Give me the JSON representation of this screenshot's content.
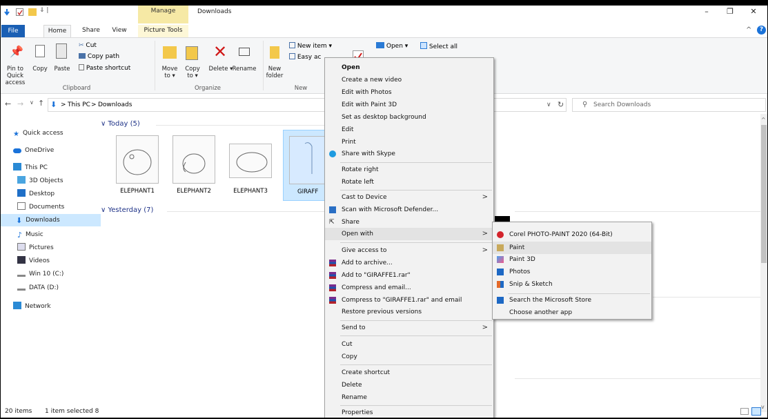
{
  "titlebar": {
    "manage_label": "Manage",
    "window_title": "Downloads",
    "minimize": "–",
    "maximize": "❐",
    "close": "✕"
  },
  "tabs": {
    "file": "File",
    "home": "Home",
    "share": "Share",
    "view": "View",
    "picture_tools": "Picture Tools"
  },
  "ribbon": {
    "pin_label": "Pin to Quick access",
    "copy_label": "Copy",
    "paste_label": "Paste",
    "cut": "Cut",
    "copy_path": "Copy path",
    "paste_shortcut": "Paste shortcut",
    "clipboard_group": "Clipboard",
    "move_to": "Move to ▾",
    "copy_to": "Copy to ▾",
    "delete": "Delete ▾",
    "rename": "Rename",
    "organize_group": "Organize",
    "new_folder": "New folder",
    "new_item": "New item ▾",
    "easy_access": "Easy ac",
    "new_group": "New",
    "open": "Open ▾",
    "select_all": "Select all"
  },
  "address": {
    "path_root": "This PC",
    "path_sep": ">",
    "path_current": "Downloads",
    "search_placeholder": "Search Downloads"
  },
  "nav": {
    "items": [
      {
        "label": "Quick access",
        "icon": "star-icon"
      },
      {
        "label": "OneDrive",
        "icon": "cloud-icon"
      },
      {
        "label": "This PC",
        "icon": "pc-icon"
      },
      {
        "label": "3D Objects",
        "icon": "cube-icon"
      },
      {
        "label": "Desktop",
        "icon": "desktop-icon"
      },
      {
        "label": "Documents",
        "icon": "document-icon"
      },
      {
        "label": "Downloads",
        "icon": "download-icon"
      },
      {
        "label": "Music",
        "icon": "music-icon"
      },
      {
        "label": "Pictures",
        "icon": "pictures-icon"
      },
      {
        "label": "Videos",
        "icon": "video-icon"
      },
      {
        "label": "Win 10  (C:)",
        "icon": "drive-icon"
      },
      {
        "label": "DATA (D:)",
        "icon": "drive-icon"
      },
      {
        "label": "Network",
        "icon": "network-icon"
      }
    ]
  },
  "content": {
    "group_today": "Today (5)",
    "group_yesterday": "Yesterday (7)",
    "files": [
      "ELEPHANT1",
      "ELEPHANT2",
      "ELEPHANT3",
      "GIRAFF"
    ]
  },
  "status": {
    "items_count": "20 items",
    "selected": "1 item selected  8"
  },
  "context_menu": {
    "items": [
      "Open",
      "Create a new video",
      "Edit with Photos",
      "Edit with Paint 3D",
      "Set as desktop background",
      "Edit",
      "Print",
      "Share with Skype",
      "Rotate right",
      "Rotate left",
      "Cast to Device",
      "Scan with Microsoft Defender...",
      "Share",
      "Open with",
      "Give access to",
      "Add to archive...",
      "Add to \"GIRAFFE1.rar\"",
      "Compress and email...",
      "Compress to \"GIRAFFE1.rar\" and email",
      "Restore previous versions",
      "Send to",
      "Cut",
      "Copy",
      "Create shortcut",
      "Delete",
      "Rename",
      "Properties"
    ]
  },
  "open_with_menu": {
    "items": [
      "Corel PHOTO-PAINT 2020 (64-Bit)",
      "Paint",
      "Paint 3D",
      "Photos",
      "Snip & Sketch",
      "Search the Microsoft Store",
      "Choose another app"
    ]
  },
  "colors": {
    "accent": "#1a5fb4",
    "selection": "#cce8ff",
    "manage_bg": "#f6e9a5"
  }
}
